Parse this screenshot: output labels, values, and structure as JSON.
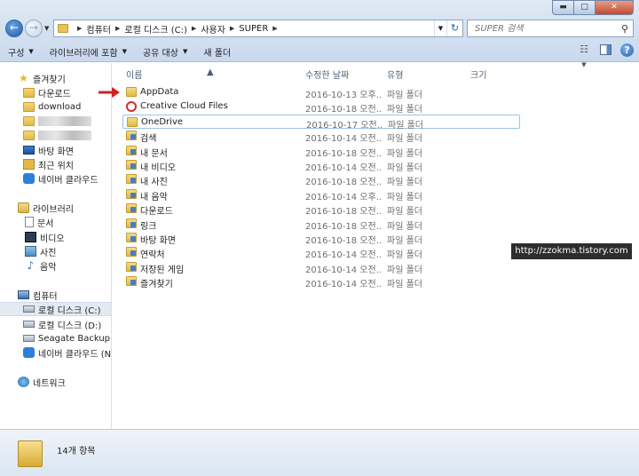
{
  "window": {
    "minimize_glyph": "▬",
    "maximize_glyph": "□",
    "close_glyph": "✕"
  },
  "address": {
    "crumbs": [
      "컴퓨터",
      "로컬 디스크 (C:)",
      "사용자",
      "SUPER"
    ],
    "refresh_glyph": "↻"
  },
  "search": {
    "placeholder": "SUPER 검색"
  },
  "toolbar": {
    "organize": "구성",
    "include_library": "라이브러리에 포함",
    "share": "공유 대상",
    "new_folder": "새 폴더"
  },
  "nav": {
    "favorites_header": "즐겨찾기",
    "favorites": [
      "다운로드",
      "download",
      "",
      "",
      "바탕 화면",
      "최근 위치",
      "네이버 클라우드"
    ],
    "libraries_header": "라이브러리",
    "libraries": [
      "문서",
      "비디오",
      "사진",
      "음악"
    ],
    "computer_header": "컴퓨터",
    "drives": [
      "로컬 디스크 (C:)",
      "로컬 디스크 (D:)",
      "Seagate Backup Plu",
      "네이버 클라우드 (N"
    ],
    "network_header": "네트워크"
  },
  "columns": {
    "name": "이름",
    "modified": "수정한 날짜",
    "type": "유형",
    "size": "크기"
  },
  "files": [
    {
      "name": "AppData",
      "date": "2016-10-13 오후...",
      "type": "파일 폴더",
      "icon": "folder-icon"
    },
    {
      "name": "Creative Cloud Files",
      "date": "2016-10-18 오전...",
      "type": "파일 폴더",
      "icon": "creative-cloud-icon"
    },
    {
      "name": "OneDrive",
      "date": "2016-10-17 오전...",
      "type": "파일 폴더",
      "icon": "folder-icon"
    },
    {
      "name": "검색",
      "date": "2016-10-14 오전...",
      "type": "파일 폴더",
      "icon": "search-folder-icon"
    },
    {
      "name": "내 문서",
      "date": "2016-10-18 오전...",
      "type": "파일 폴더",
      "icon": "documents-folder-icon"
    },
    {
      "name": "내 비디오",
      "date": "2016-10-14 오전...",
      "type": "파일 폴더",
      "icon": "videos-folder-icon"
    },
    {
      "name": "내 사진",
      "date": "2016-10-18 오전...",
      "type": "파일 폴더",
      "icon": "pictures-folder-icon"
    },
    {
      "name": "내 음악",
      "date": "2016-10-14 오후...",
      "type": "파일 폴더",
      "icon": "music-folder-icon"
    },
    {
      "name": "다운로드",
      "date": "2016-10-18 오전...",
      "type": "파일 폴더",
      "icon": "downloads-folder-icon"
    },
    {
      "name": "링크",
      "date": "2016-10-18 오전...",
      "type": "파일 폴더",
      "icon": "links-folder-icon"
    },
    {
      "name": "바탕 화면",
      "date": "2016-10-18 오전...",
      "type": "파일 폴더",
      "icon": "desktop-folder-icon"
    },
    {
      "name": "연락처",
      "date": "2016-10-14 오전...",
      "type": "파일 폴더",
      "icon": "contacts-folder-icon"
    },
    {
      "name": "저장된 게임",
      "date": "2016-10-14 오전...",
      "type": "파일 폴더",
      "icon": "saved-games-folder-icon"
    },
    {
      "name": "즐겨찾기",
      "date": "2016-10-14 오전...",
      "type": "파일 폴더",
      "icon": "favorites-folder-icon"
    }
  ],
  "watermark": "http://zzokma.tistory.com",
  "status": {
    "item_count": "14개 항목"
  },
  "colors": {
    "annotation_arrow": "#d62020",
    "selection_border": "#9cc3ea"
  }
}
